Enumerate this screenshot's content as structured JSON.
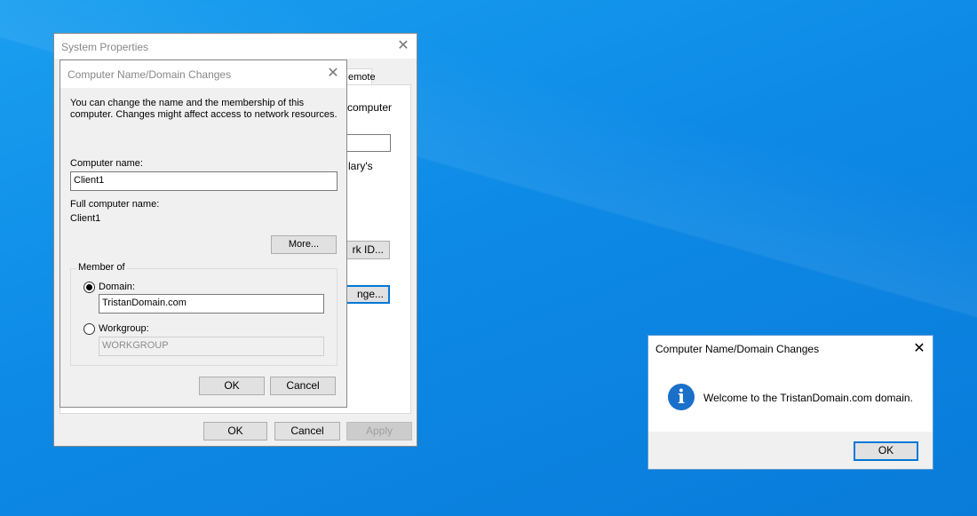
{
  "sysprops": {
    "title": "System Properties",
    "visible_tab": "emote",
    "frag_computer": "computer",
    "frag_library": "lary's",
    "frag_network_id": "rk ID...",
    "frag_change": "nge...",
    "ok": "OK",
    "cancel": "Cancel",
    "apply": "Apply"
  },
  "cndc": {
    "title": "Computer Name/Domain Changes",
    "description": "You can change the name and the membership of this computer. Changes might affect access to network resources.",
    "computer_name_label": "Computer name:",
    "computer_name_value": "Client1",
    "full_name_label": "Full computer name:",
    "full_name_value": "Client1",
    "more": "More...",
    "member_of": "Member of",
    "domain_label": "Domain:",
    "domain_value": "TristanDomain.com",
    "workgroup_label": "Workgroup:",
    "workgroup_value": "WORKGROUP",
    "ok": "OK",
    "cancel": "Cancel"
  },
  "msg": {
    "title": "Computer Name/Domain Changes",
    "text": "Welcome to the TristanDomain.com domain.",
    "ok": "OK",
    "icon": "info-icon"
  }
}
